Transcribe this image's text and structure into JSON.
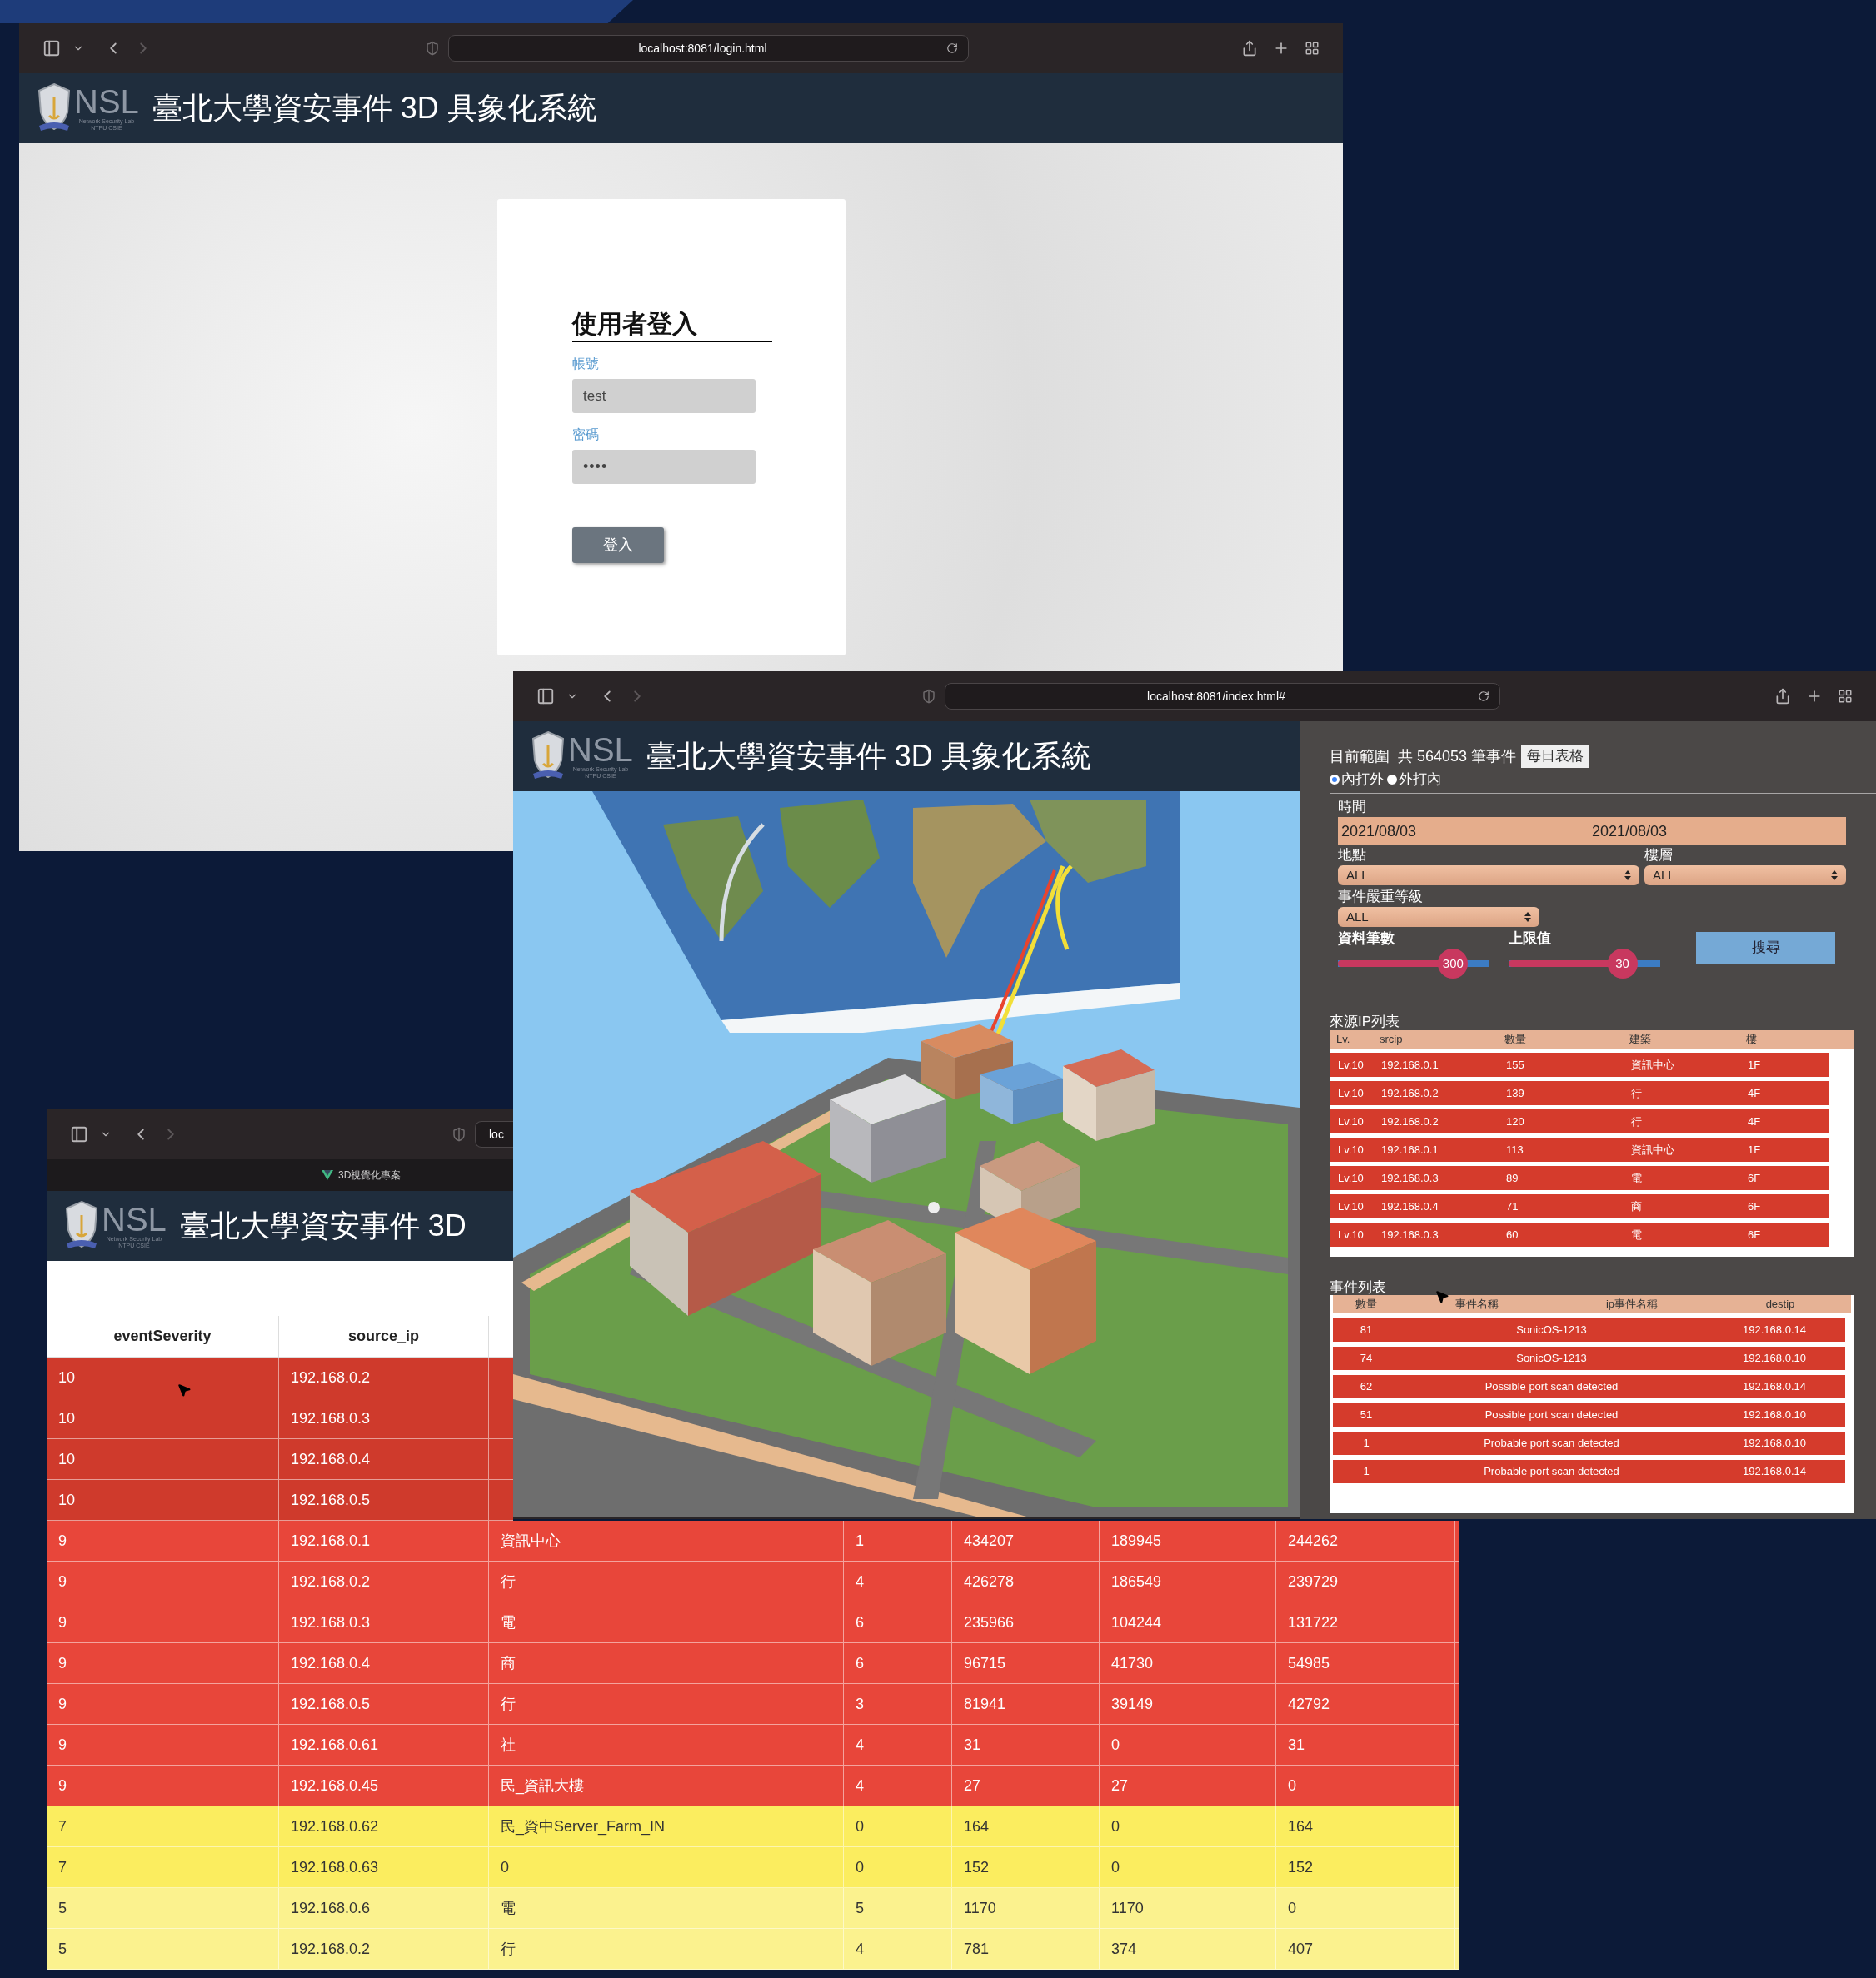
{
  "login_window": {
    "url": "localhost:8081/login.html",
    "header": {
      "logo_text": "NSL",
      "logo_subtitle": [
        "Network Security Lab",
        "NTPU CSIE"
      ],
      "title": "臺北大學資安事件 3D 具象化系統"
    },
    "login_form": {
      "title": "使用者登入",
      "fields": [
        {
          "label": "帳號",
          "value": "test",
          "kind": "text"
        },
        {
          "label": "密碼",
          "value": "••••",
          "kind": "password"
        }
      ],
      "button": "登入"
    }
  },
  "index_window": {
    "url": "localhost:8081/index.html#",
    "header": {
      "logo_text": "NSL",
      "logo_subtitle": [
        "Network Security Lab",
        "NTPU CSIE"
      ],
      "title": "臺北大學資安事件 3D 具象化系統"
    },
    "panel": {
      "summary": "目前範圍  共 564053 筆事件",
      "daily_table_button": "每日表格",
      "radios": [
        {
          "label": "內打外",
          "selected": true
        },
        {
          "label": "外打內",
          "selected": false
        }
      ],
      "time": {
        "label": "時間",
        "start": "2021/08/03",
        "end": "2021/08/03"
      },
      "location": {
        "label": "地點",
        "value": "ALL"
      },
      "floor": {
        "label": "樓層",
        "value": "ALL"
      },
      "severity": {
        "label": "事件嚴重等級",
        "value": "ALL"
      },
      "sliders": [
        {
          "label": "資料筆數",
          "reading": "300",
          "level": 0.76
        },
        {
          "label": "上限值",
          "reading": "30",
          "level": 0.75
        }
      ],
      "search_button": "搜尋",
      "source_ip_list": {
        "title": "來源IP列表",
        "columns": [
          "Lv.",
          "srcip",
          "數量",
          "建築",
          "樓"
        ],
        "rows": [
          [
            "Lv.10",
            "192.168.0.1",
            "155",
            "資訊中心",
            "1F"
          ],
          [
            "Lv.10",
            "192.168.0.2",
            "139",
            "行",
            "4F"
          ],
          [
            "Lv.10",
            "192.168.0.2",
            "120",
            "行",
            "4F"
          ],
          [
            "Lv.10",
            "192.168.0.1",
            "113",
            "資訊中心",
            "1F"
          ],
          [
            "Lv.10",
            "192.168.0.3",
            "89",
            "電",
            "6F"
          ],
          [
            "Lv.10",
            "192.168.0.4",
            "71",
            "商",
            "6F"
          ],
          [
            "Lv.10",
            "192.168.0.3",
            "60",
            "電",
            "6F"
          ]
        ]
      },
      "event_list": {
        "title": "事件列表",
        "columns": [
          "數量",
          "事件名稱",
          "ip事件名稱",
          "destip"
        ],
        "rows": [
          {
            "count": "81",
            "name": "SonicOS-1213",
            "destip": "192.168.0.14"
          },
          {
            "count": "74",
            "name": "SonicOS-1213",
            "destip": "192.168.0.10"
          },
          {
            "count": "62",
            "name": "Possible port scan detected",
            "destip": "192.168.0.14"
          },
          {
            "count": "51",
            "name": "Possible port scan detected",
            "destip": "192.168.0.10"
          },
          {
            "count": "1",
            "name": "Probable port scan detected",
            "destip": "192.168.0.10"
          },
          {
            "count": "1",
            "name": "Probable port scan detected",
            "destip": "192.168.0.14"
          }
        ]
      }
    }
  },
  "table_window": {
    "url": "loc",
    "tab_label": "3D視覺化專案",
    "header": {
      "logo_text": "NSL",
      "logo_subtitle": [
        "Network Security Lab",
        "NTPU CSIE"
      ],
      "title": "臺北大學資安事件 3D"
    },
    "columns": [
      "eventSeverity",
      "source_ip"
    ],
    "rows": [
      {
        "color": "#cf3a2c",
        "cells": [
          "10",
          "192.168.0.2"
        ]
      },
      {
        "color": "#cf3a2c",
        "cells": [
          "10",
          "192.168.0.3"
        ]
      },
      {
        "color": "#cf3a2c",
        "cells": [
          "10",
          "192.168.0.4"
        ]
      },
      {
        "color": "#cf3a2c",
        "cells": [
          "10",
          "192.168.0.5"
        ]
      },
      {
        "color": "#e8463a",
        "cells": [
          "9",
          "192.168.0.1",
          "資訊中心",
          "1",
          "434207",
          "189945",
          "244262"
        ]
      },
      {
        "color": "#e8463a",
        "cells": [
          "9",
          "192.168.0.2",
          "行",
          "4",
          "426278",
          "186549",
          "239729"
        ]
      },
      {
        "color": "#e8463a",
        "cells": [
          "9",
          "192.168.0.3",
          "電",
          "6",
          "235966",
          "104244",
          "131722"
        ]
      },
      {
        "color": "#e8463a",
        "cells": [
          "9",
          "192.168.0.4",
          "商",
          "6",
          "96715",
          "41730",
          "54985"
        ]
      },
      {
        "color": "#e8463a",
        "cells": [
          "9",
          "192.168.0.5",
          "行",
          "3",
          "81941",
          "39149",
          "42792"
        ]
      },
      {
        "color": "#e8463a",
        "cells": [
          "9",
          "192.168.0.61",
          "社",
          "4",
          "31",
          "0",
          "31"
        ]
      },
      {
        "color": "#e8463a",
        "cells": [
          "9",
          "192.168.0.45",
          "民_資訊大樓",
          "4",
          "27",
          "27",
          "0"
        ]
      },
      {
        "color": "#fbed5f",
        "cells": [
          "7",
          "192.168.0.62",
          "民_資中Server_Farm_IN",
          "0",
          "164",
          "0",
          "164"
        ]
      },
      {
        "color": "#fbed5f",
        "cells": [
          "7",
          "192.168.0.63",
          "0",
          "0",
          "152",
          "0",
          "152"
        ]
      },
      {
        "color": "#fbf28e",
        "cells": [
          "5",
          "192.168.0.6",
          "電",
          "5",
          "1170",
          "1170",
          "0"
        ]
      },
      {
        "color": "#fbf28e",
        "cells": [
          "5",
          "192.168.0.2",
          "行",
          "4",
          "781",
          "374",
          "407"
        ]
      }
    ]
  }
}
